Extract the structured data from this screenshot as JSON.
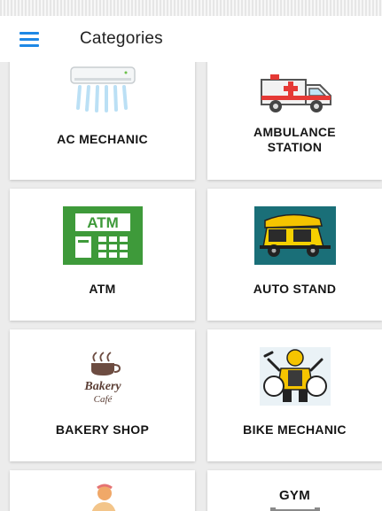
{
  "app_bar": {
    "title": "Categories",
    "menu_icon": "hamburger-menu-icon",
    "accent": "#1e88e5"
  },
  "categories": [
    {
      "label": "AC MECHANIC",
      "icon": "air-conditioner-icon"
    },
    {
      "label": "AMBULANCE\nSTATION",
      "icon": "ambulance-icon"
    },
    {
      "label": "ATM",
      "icon": "atm-icon"
    },
    {
      "label": "AUTO STAND",
      "icon": "auto-rickshaw-icon"
    },
    {
      "label": "BAKERY SHOP",
      "icon": "bakery-cafe-icon"
    },
    {
      "label": "BIKE MECHANIC",
      "icon": "bike-mechanic-icon"
    },
    {
      "label": "",
      "icon": "person-icon"
    },
    {
      "label": "GYM",
      "icon": "gym-icon"
    }
  ],
  "atm_icon_text": "ATM",
  "bakery_icon_text": "Bakery Café"
}
